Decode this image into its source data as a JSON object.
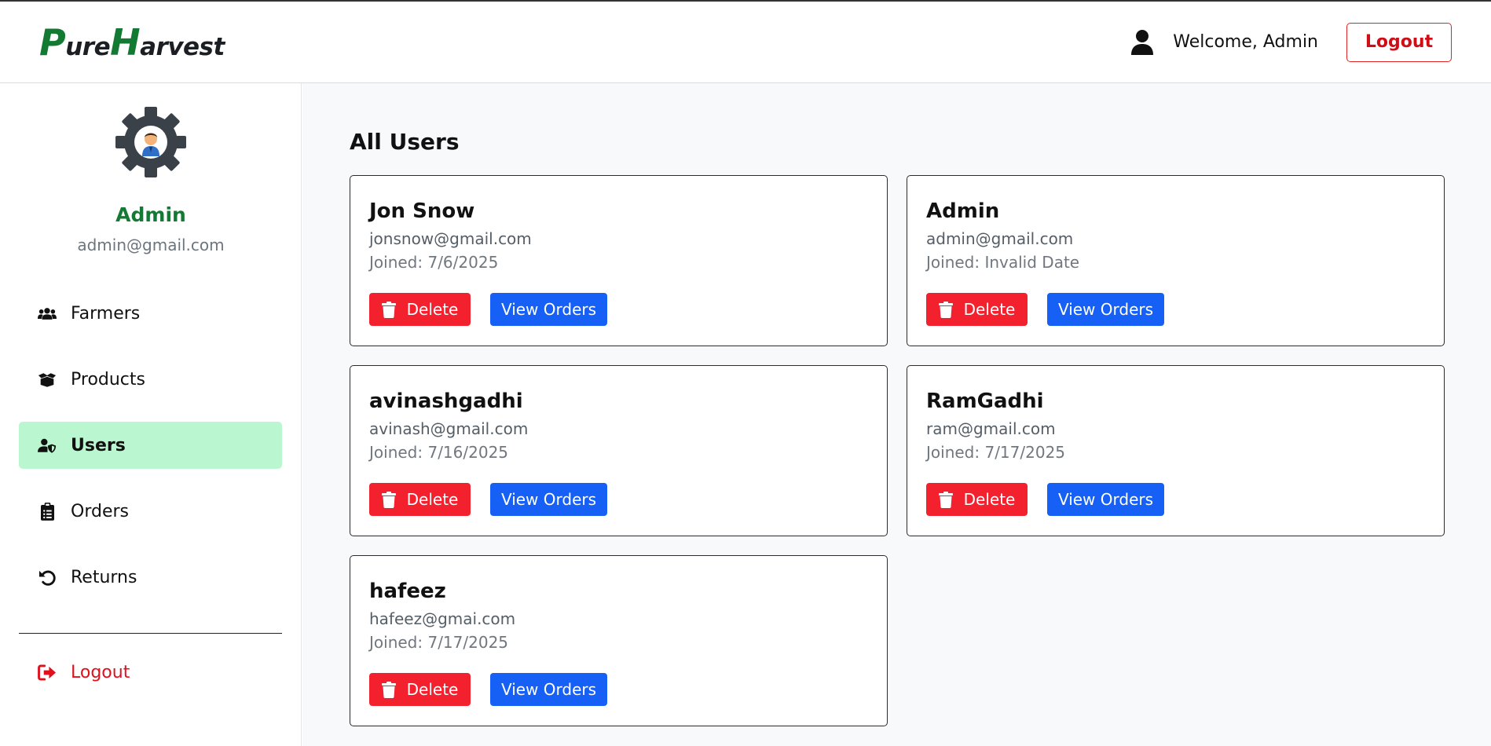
{
  "header": {
    "logo_p": "P",
    "logo_ure": "ure",
    "logo_h": "H",
    "logo_arvest": "arvest",
    "welcome": "Welcome, Admin",
    "logout_label": "Logout"
  },
  "sidebar": {
    "admin_name": "Admin",
    "admin_email": "admin@gmail.com",
    "items": [
      {
        "label": "Farmers",
        "icon": "users-group-icon",
        "active": false
      },
      {
        "label": "Products",
        "icon": "box-open-icon",
        "active": false
      },
      {
        "label": "Users",
        "icon": "user-shield-icon",
        "active": true
      },
      {
        "label": "Orders",
        "icon": "clipboard-list-icon",
        "active": false
      },
      {
        "label": "Returns",
        "icon": "undo-icon",
        "active": false
      }
    ],
    "logout_label": "Logout"
  },
  "main": {
    "title": "All Users",
    "delete_label": "Delete",
    "view_orders_label": "View Orders",
    "users": [
      {
        "name": "Jon Snow",
        "email": "jonsnow@gmail.com",
        "joined": "Joined: 7/6/2025"
      },
      {
        "name": "Admin",
        "email": "admin@gmail.com",
        "joined": "Joined: Invalid Date"
      },
      {
        "name": "avinashgadhi",
        "email": "avinash@gmail.com",
        "joined": "Joined: 7/16/2025"
      },
      {
        "name": "RamGadhi",
        "email": "ram@gmail.com",
        "joined": "Joined: 7/17/2025"
      },
      {
        "name": "hafeez",
        "email": "hafeez@gmai.com",
        "joined": "Joined: 7/17/2025"
      }
    ]
  },
  "colors": {
    "brand_green": "#127a33",
    "active_nav": "#baf6cf",
    "danger": "#f3202e",
    "primary": "#1660f5"
  }
}
